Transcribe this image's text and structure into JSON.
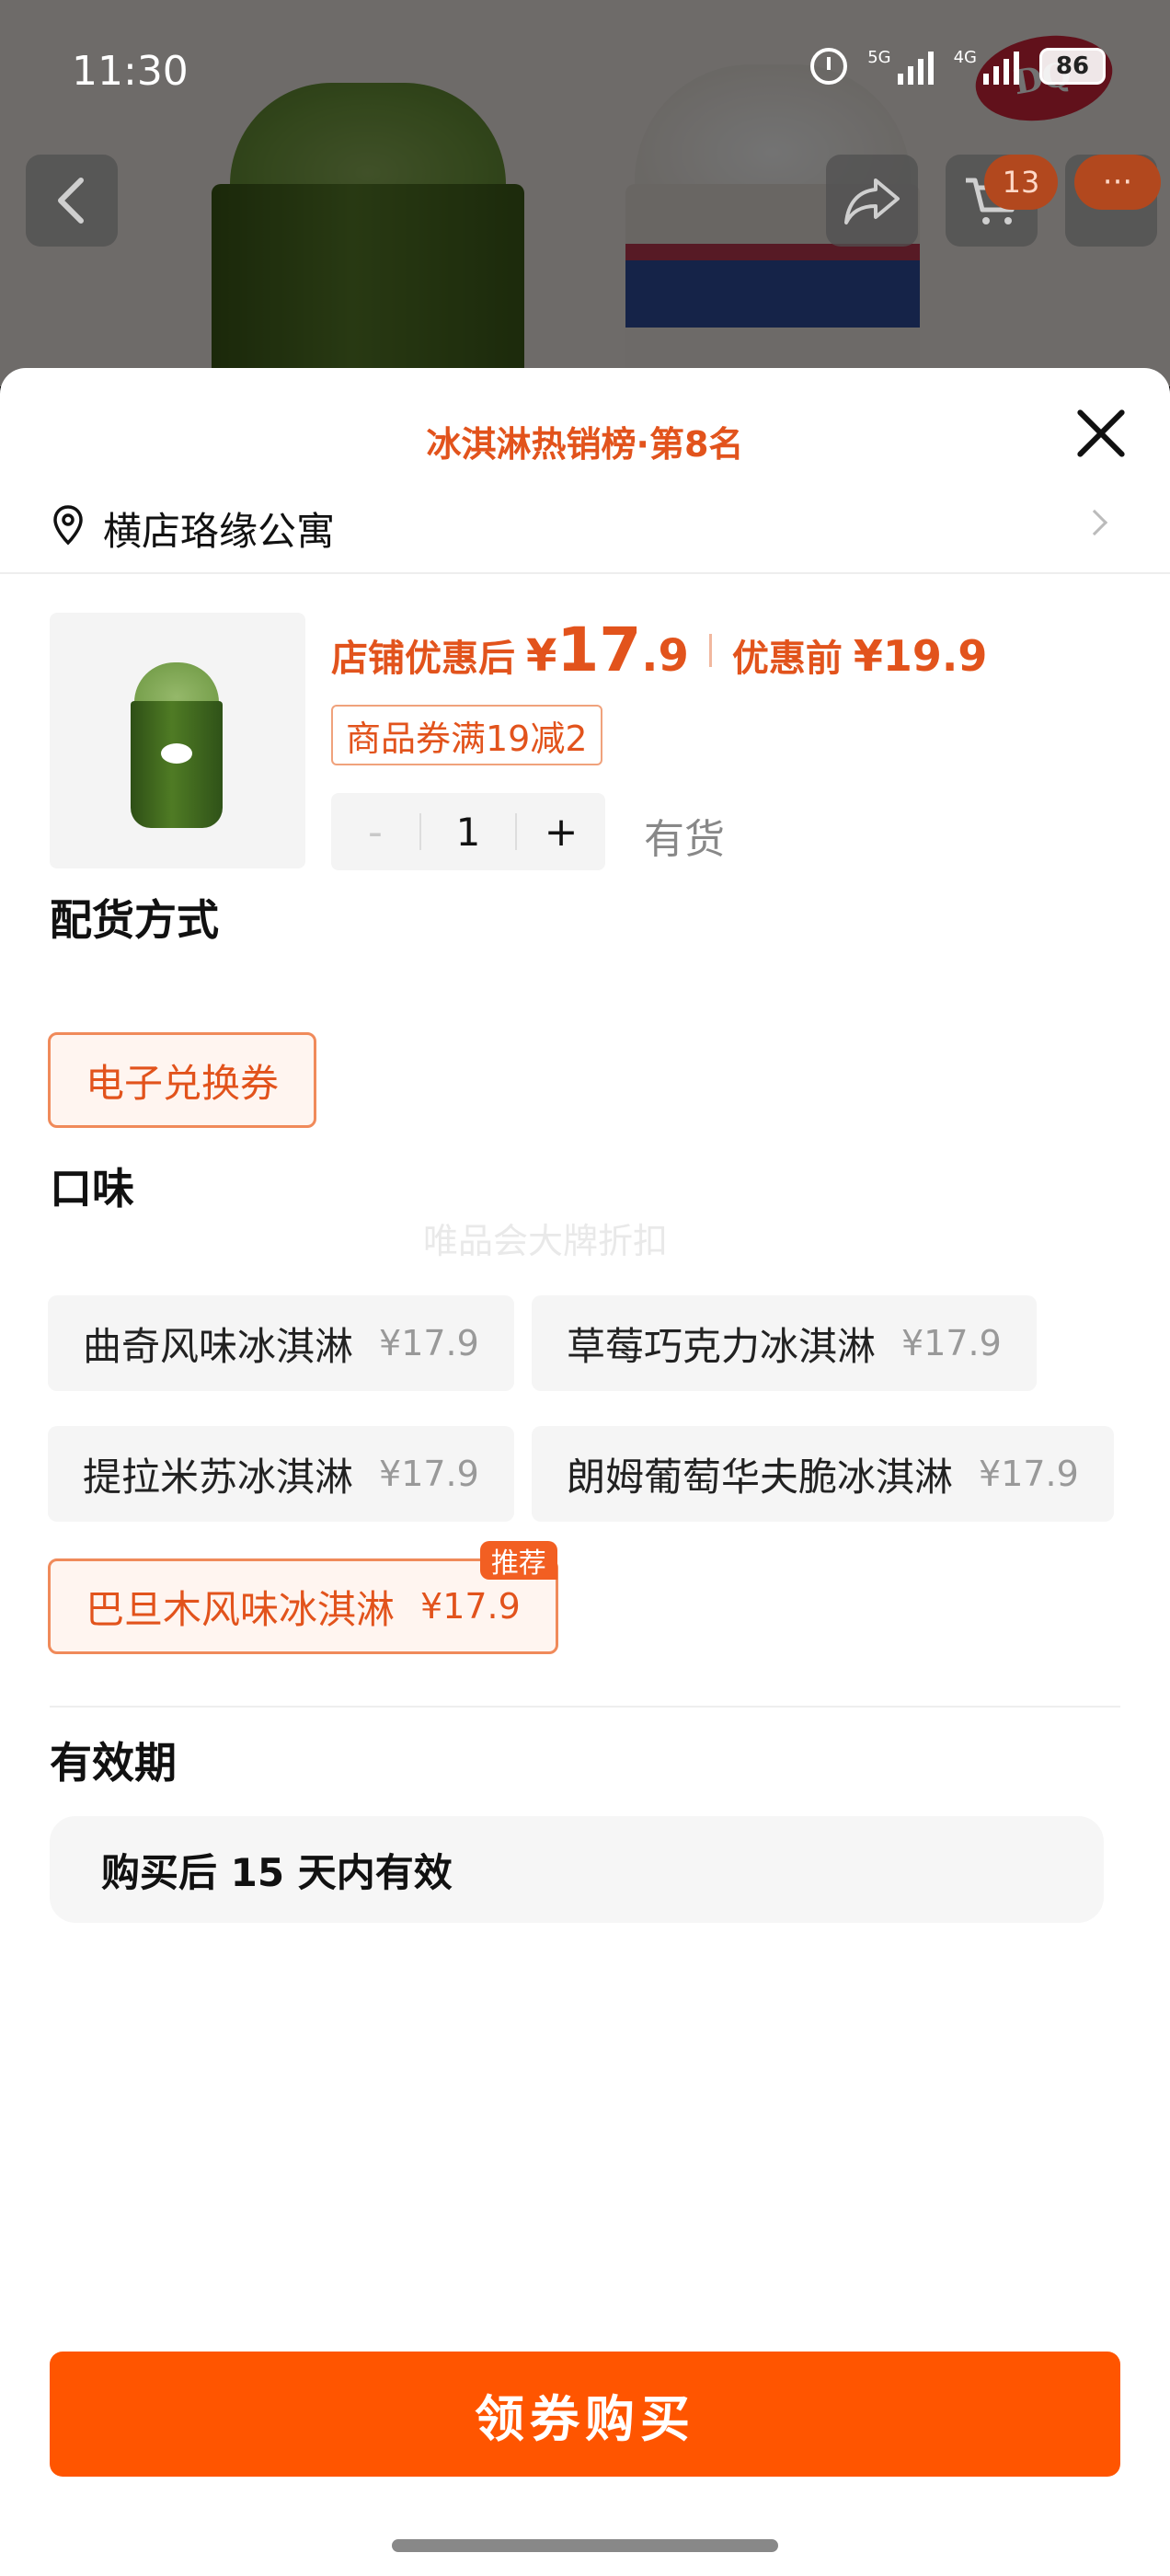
{
  "status_bar": {
    "time": "11:30",
    "net1": "5G",
    "net2": "4G",
    "battery": "86"
  },
  "background": {
    "brand_logo": "DQ",
    "cart_count": "13",
    "more_label": "···"
  },
  "sheet": {
    "title": "冰淇淋热销榜·第8名",
    "address": "横店珞缘公寓",
    "price": {
      "after_label": "店铺优惠后",
      "currency": "¥",
      "after_int": "17",
      "after_dec": ".9",
      "before_label": "优惠前",
      "before_value": "¥19.9"
    },
    "coupon": "商品券满19减2",
    "stepper": {
      "minus": "-",
      "qty": "1",
      "plus": "+"
    },
    "stock": "有货",
    "delivery": {
      "heading": "配货方式",
      "options": [
        "电子兑换券"
      ]
    },
    "flavor": {
      "heading": "口味",
      "options": [
        {
          "name": "曲奇风味冰淇淋",
          "price": "¥17.9"
        },
        {
          "name": "草莓巧克力冰淇淋",
          "price": "¥17.9"
        },
        {
          "name": "提拉米苏冰淇淋",
          "price": "¥17.9"
        },
        {
          "name": "朗姆葡萄华夫脆冰淇淋",
          "price": "¥17.9"
        },
        {
          "name": "巴旦木风味冰淇淋",
          "price": "¥17.9",
          "badge": "推荐"
        }
      ]
    },
    "watermark": "唯品会大牌折扣",
    "validity": {
      "heading": "有效期",
      "text": "购买后 15 天内有效"
    },
    "buy_button": "领券购买"
  },
  "colors": {
    "accent": "#e2531c",
    "button": "#ff5500",
    "selected_bg": "#fff5f0"
  }
}
